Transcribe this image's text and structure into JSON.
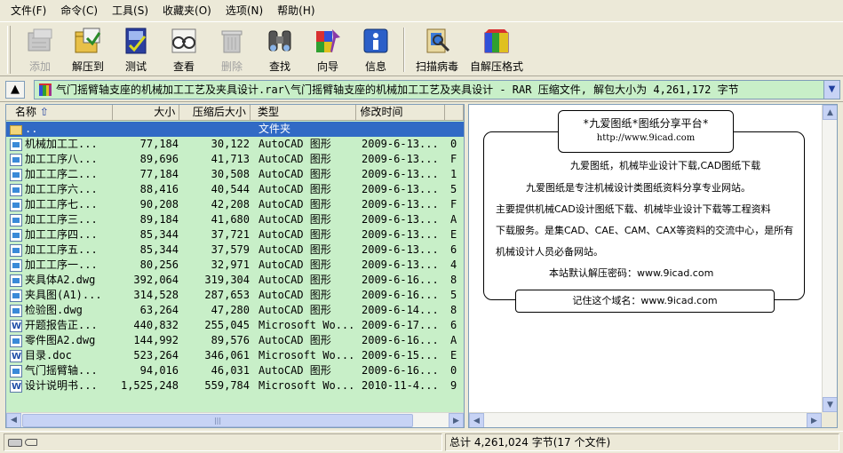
{
  "menu": [
    {
      "label": "文件(F)"
    },
    {
      "label": "命令(C)"
    },
    {
      "label": "工具(S)"
    },
    {
      "label": "收藏夹(O)"
    },
    {
      "label": "选项(N)"
    },
    {
      "label": "帮助(H)"
    }
  ],
  "toolbar": {
    "add": "添加",
    "extract_to": "解压到",
    "test": "测试",
    "view": "查看",
    "delete": "删除",
    "find": "查找",
    "wizard": "向导",
    "info": "信息",
    "virus_scan": "扫描病毒",
    "sfx": "自解压格式"
  },
  "address": {
    "path": "气门摇臂轴支座的机械加工工艺及夹具设计.rar\\气门摇臂轴支座的机械加工工艺及夹具设计 - RAR 压缩文件, 解包大小为 4,261,172 字节"
  },
  "columns": {
    "name": "名称",
    "size": "大小",
    "packed": "压缩后大小",
    "type": "类型",
    "modified": "修改时间"
  },
  "files": [
    {
      "icon": "folder",
      "name": "..",
      "size": "",
      "packed": "",
      "type": "文件夹",
      "modified": "",
      "extra": ""
    },
    {
      "icon": "dwg",
      "name": "机械加工工...",
      "size": "77,184",
      "packed": "30,122",
      "type": "AutoCAD 图形",
      "modified": "2009-6-13...",
      "extra": "0"
    },
    {
      "icon": "dwg",
      "name": "加工工序八...",
      "size": "89,696",
      "packed": "41,713",
      "type": "AutoCAD 图形",
      "modified": "2009-6-13...",
      "extra": "F"
    },
    {
      "icon": "dwg",
      "name": "加工工序二...",
      "size": "77,184",
      "packed": "30,508",
      "type": "AutoCAD 图形",
      "modified": "2009-6-13...",
      "extra": "1"
    },
    {
      "icon": "dwg",
      "name": "加工工序六...",
      "size": "88,416",
      "packed": "40,544",
      "type": "AutoCAD 图形",
      "modified": "2009-6-13...",
      "extra": "5"
    },
    {
      "icon": "dwg",
      "name": "加工工序七...",
      "size": "90,208",
      "packed": "42,208",
      "type": "AutoCAD 图形",
      "modified": "2009-6-13...",
      "extra": "F"
    },
    {
      "icon": "dwg",
      "name": "加工工序三...",
      "size": "89,184",
      "packed": "41,680",
      "type": "AutoCAD 图形",
      "modified": "2009-6-13...",
      "extra": "A"
    },
    {
      "icon": "dwg",
      "name": "加工工序四...",
      "size": "85,344",
      "packed": "37,721",
      "type": "AutoCAD 图形",
      "modified": "2009-6-13...",
      "extra": "E"
    },
    {
      "icon": "dwg",
      "name": "加工工序五...",
      "size": "85,344",
      "packed": "37,579",
      "type": "AutoCAD 图形",
      "modified": "2009-6-13...",
      "extra": "6"
    },
    {
      "icon": "dwg",
      "name": "加工工序一...",
      "size": "80,256",
      "packed": "32,971",
      "type": "AutoCAD 图形",
      "modified": "2009-6-13...",
      "extra": "4"
    },
    {
      "icon": "dwg",
      "name": "夹具体A2.dwg",
      "size": "392,064",
      "packed": "319,304",
      "type": "AutoCAD 图形",
      "modified": "2009-6-16...",
      "extra": "8"
    },
    {
      "icon": "dwg",
      "name": "夹具图(A1)...",
      "size": "314,528",
      "packed": "287,653",
      "type": "AutoCAD 图形",
      "modified": "2009-6-16...",
      "extra": "5"
    },
    {
      "icon": "dwg",
      "name": "检验图.dwg",
      "size": "63,264",
      "packed": "47,280",
      "type": "AutoCAD 图形",
      "modified": "2009-6-14...",
      "extra": "8"
    },
    {
      "icon": "doc",
      "name": "开题报告正...",
      "size": "440,832",
      "packed": "255,045",
      "type": "Microsoft Wo...",
      "modified": "2009-6-17...",
      "extra": "6"
    },
    {
      "icon": "dwg",
      "name": "零件图A2.dwg",
      "size": "144,992",
      "packed": "89,576",
      "type": "AutoCAD 图形",
      "modified": "2009-6-16...",
      "extra": "A"
    },
    {
      "icon": "doc",
      "name": "目录.doc",
      "size": "523,264",
      "packed": "346,061",
      "type": "Microsoft Wo...",
      "modified": "2009-6-15...",
      "extra": "E"
    },
    {
      "icon": "dwg",
      "name": "气门摇臂轴...",
      "size": "94,016",
      "packed": "46,031",
      "type": "AutoCAD 图形",
      "modified": "2009-6-16...",
      "extra": "0"
    },
    {
      "icon": "doc",
      "name": "设计说明书...",
      "size": "1,525,248",
      "packed": "559,784",
      "type": "Microsoft Wo...",
      "modified": "2010-11-4...",
      "extra": "9"
    }
  ],
  "comment": {
    "title": "*九爱图纸*图纸分享平台*",
    "url": "http://www.9icad.com",
    "line1": "九爱图纸，机械毕业设计下载,CAD图纸下载",
    "line2": "九爱图纸是专注机械设计类图纸资料分享专业网站。",
    "line3": "主要提供机械CAD设计图纸下载、机械毕业设计下载等工程资料",
    "line4": "下载服务。是集CAD、CAE、CAM、CAX等资料的交流中心，是所有",
    "line5": "机械设计人员必备网站。",
    "password": "本站默认解压密码：www.9icad.com",
    "remember": "记住这个域名：www.9icad.com"
  },
  "status": {
    "total": "总计 4,261,024 字节(17 个文件)"
  },
  "colors": {
    "list_bg": "#c8efc8",
    "selection": "#316ac5",
    "chrome": "#ece9d8"
  }
}
